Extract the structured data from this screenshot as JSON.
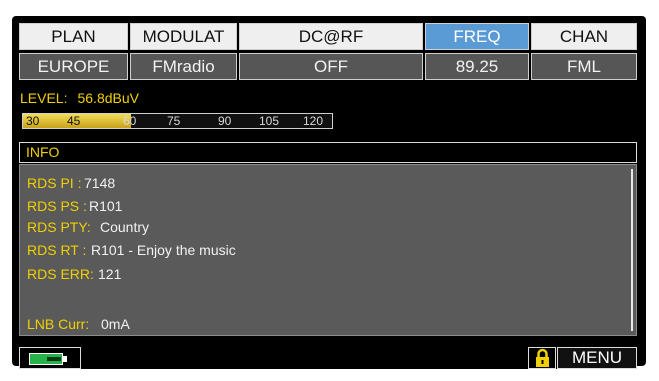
{
  "header": {
    "tabs": [
      {
        "label": "PLAN",
        "value": "EUROPE",
        "selected": false
      },
      {
        "label": "MODULAT",
        "value": "FMradio",
        "selected": false
      },
      {
        "label": "DC@RF",
        "value": "OFF",
        "selected": false
      },
      {
        "label": "FREQ",
        "value": "89.25",
        "selected": true
      },
      {
        "label": "CHAN",
        "value": "FML",
        "selected": false
      }
    ]
  },
  "level": {
    "label": "LEVEL:",
    "value": "56.8dBuV",
    "bar_fraction": 0.35,
    "scale": [
      "30",
      "45",
      "60",
      "75",
      "90",
      "105",
      "120"
    ]
  },
  "info": {
    "title": "INFO",
    "rows": [
      {
        "label": "RDS PI :",
        "value": "7148"
      },
      {
        "label": "RDS PS :",
        "value": "R101"
      },
      {
        "label": "RDS PTY:",
        "value": "Country"
      },
      {
        "label": "RDS RT :",
        "value": "R101 - Enjoy the music"
      },
      {
        "label": "RDS ERR:",
        "value": "121"
      },
      {
        "label": "LNB Curr:",
        "value": "0mA"
      }
    ]
  },
  "footer": {
    "battery_icon": "battery-charging-icon",
    "lock_icon": "lock-icon",
    "menu_label": "MENU"
  },
  "colors": {
    "accent_yellow": "#f0d000",
    "selected_blue": "#5b9bd5",
    "panel_gray": "#5a5a5a",
    "battery_green": "#27b24a"
  }
}
